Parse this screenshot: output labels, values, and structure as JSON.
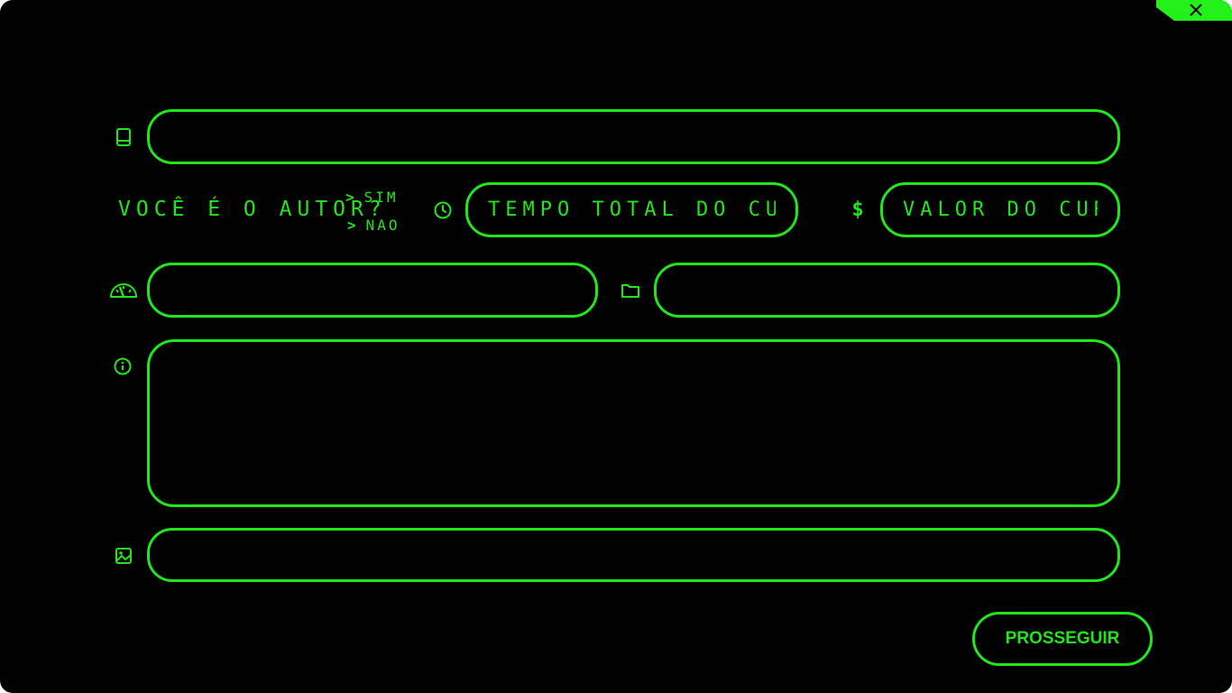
{
  "window": {
    "close_label": "close",
    "accent_color": "#22e61c"
  },
  "form": {
    "title_field": {
      "icon": "book-icon",
      "placeholder": "",
      "value": ""
    },
    "author_question": {
      "label": "VOCÊ É O AUTOR?",
      "options": [
        "SIM",
        "NAO"
      ],
      "arrow": ">"
    },
    "duration_field": {
      "icon": "clock-icon",
      "placeholder": "TEMPO TOTAL DO CURSO",
      "value": ""
    },
    "price_field": {
      "icon": "dollar-icon",
      "icon_glyph": "$",
      "placeholder": "VALOR DO CURSO",
      "value": ""
    },
    "level_field": {
      "icon": "speedometer-icon",
      "placeholder": "",
      "value": ""
    },
    "category_field": {
      "icon": "folder-icon",
      "placeholder": "",
      "value": ""
    },
    "description_field": {
      "icon": "info-icon",
      "placeholder": "",
      "value": ""
    },
    "image_field": {
      "icon": "image-icon",
      "placeholder": "",
      "value": ""
    }
  },
  "actions": {
    "continue_label": "PROSSEGUIR"
  }
}
